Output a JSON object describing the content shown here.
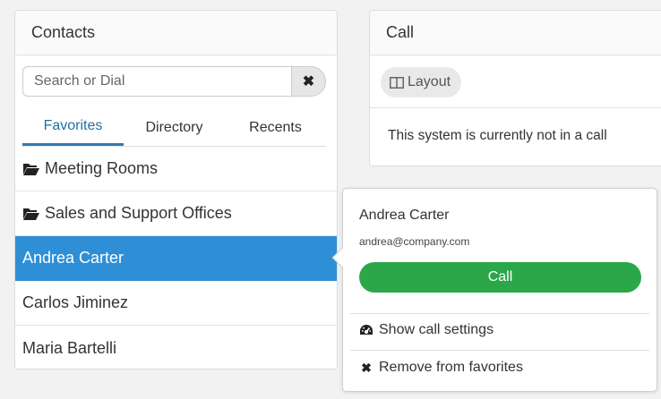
{
  "contacts": {
    "title": "Contacts",
    "search": {
      "placeholder": "Search or Dial",
      "value": "",
      "clear_icon": "close-icon"
    },
    "tabs": [
      {
        "label": "Favorites",
        "active": true
      },
      {
        "label": "Directory",
        "active": false
      },
      {
        "label": "Recents",
        "active": false
      }
    ],
    "items": [
      {
        "label": "Meeting Rooms",
        "icon": "folder-open-icon"
      },
      {
        "label": "Sales and Support Offices",
        "icon": "folder-open-icon"
      },
      {
        "label": "Andrea Carter",
        "selected": true
      },
      {
        "label": "Carlos Jiminez"
      },
      {
        "label": "Maria Bartelli"
      }
    ]
  },
  "call": {
    "title": "Call",
    "layout_label": "Layout",
    "layout_icon": "columns-icon",
    "status": "This system is currently not in a call"
  },
  "popover": {
    "name": "Andrea Carter",
    "email": "andrea@company.com",
    "call_label": "Call",
    "actions": [
      {
        "label": "Show call settings",
        "icon": "dashboard-icon"
      },
      {
        "label": "Remove from favorites",
        "icon": "close-icon"
      }
    ]
  },
  "colors": {
    "accent": "#2e8fd6",
    "tab_active": "#1f6fa8",
    "call_green": "#2ba74a"
  }
}
